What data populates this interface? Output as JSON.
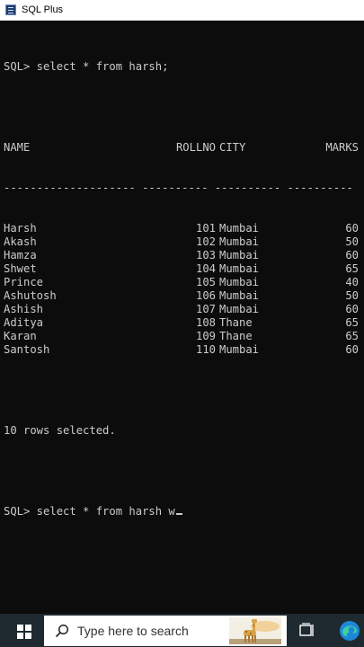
{
  "window": {
    "title": "SQL Plus"
  },
  "console": {
    "command1": "SQL> select * from harsh;",
    "headers": {
      "name": "NAME",
      "rollno": "ROLLNO",
      "city": "CITY",
      "marks": "MARKS"
    },
    "separator": "-------------------- ---------- ---------- ----------",
    "rows": [
      {
        "name": "Harsh",
        "rollno": "101",
        "city": "Mumbai",
        "marks": "60"
      },
      {
        "name": "Akash",
        "rollno": "102",
        "city": "Mumbai",
        "marks": "50"
      },
      {
        "name": "Hamza",
        "rollno": "103",
        "city": "Mumbai",
        "marks": "60"
      },
      {
        "name": "Shwet",
        "rollno": "104",
        "city": "Mumbai",
        "marks": "65"
      },
      {
        "name": "Prince",
        "rollno": "105",
        "city": "Mumbai",
        "marks": "40"
      },
      {
        "name": "Ashutosh",
        "rollno": "106",
        "city": "Mumbai",
        "marks": "50"
      },
      {
        "name": "Ashish",
        "rollno": "107",
        "city": "Mumbai",
        "marks": "60"
      },
      {
        "name": "Aditya",
        "rollno": "108",
        "city": "Thane",
        "marks": "65"
      },
      {
        "name": "Karan",
        "rollno": "109",
        "city": "Thane",
        "marks": "65"
      },
      {
        "name": "Santosh",
        "rollno": "110",
        "city": "Mumbai",
        "marks": "60"
      }
    ],
    "summary": "10 rows selected.",
    "command2": "SQL> select * from harsh w"
  },
  "taskbar": {
    "search_placeholder": "Type here to search"
  },
  "colors": {
    "console_bg": "#0c0c0c",
    "console_text": "#cccccc",
    "taskbar_bg": "#1f2a30"
  }
}
